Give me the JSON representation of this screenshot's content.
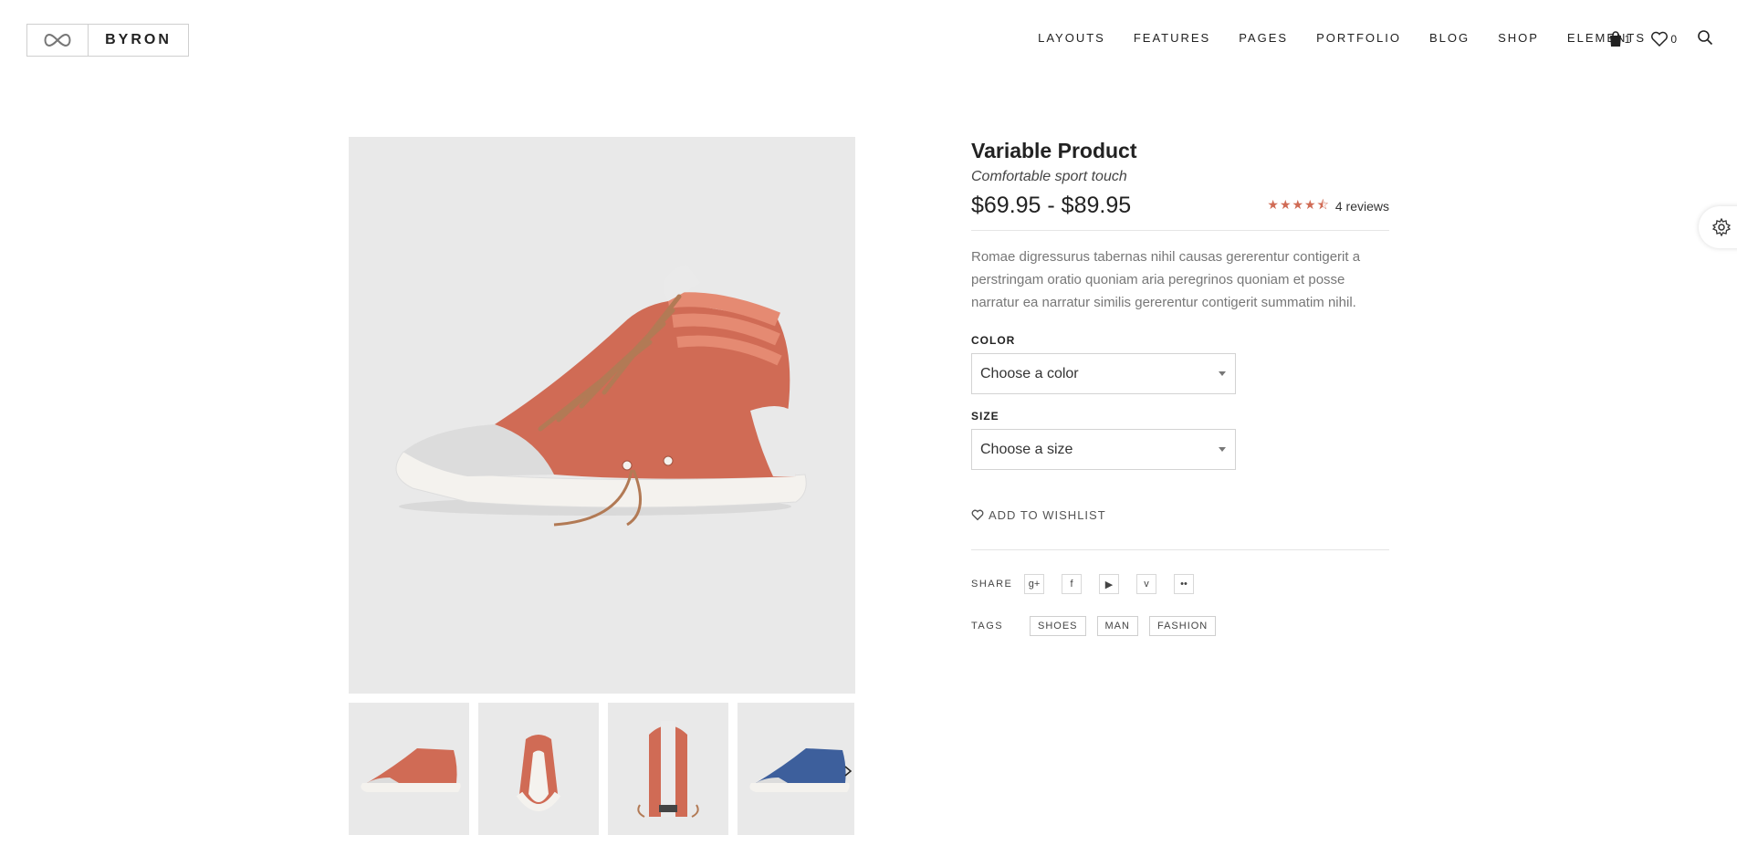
{
  "brand": {
    "name": "BYRON",
    "logo_icon": "infinity-icon"
  },
  "nav": {
    "items": [
      "LAYOUTS",
      "FEATURES",
      "PAGES",
      "PORTFOLIO",
      "BLOG",
      "SHOP",
      "ELEMENTS"
    ]
  },
  "header_icons": {
    "cart_count": "1",
    "wishlist_count": "0",
    "search_icon": "search-icon"
  },
  "product": {
    "title": "Variable Product",
    "subtitle": "Comfortable sport touch",
    "price": "$69.95 - $89.95",
    "rating": 4.5,
    "reviews_text": "4 reviews",
    "description": "Romae digressurus tabernas nihil causas gererentur contigerit a perstringam oratio quoniam aria peregrinos quoniam et posse narratur ea narratur similis gererentur contigerit summatim nihil.",
    "color_label": "COLOR",
    "color_placeholder": "Choose a color",
    "size_label": "SIZE",
    "size_placeholder": "Choose a size",
    "wishlist_label": "ADD TO WISHLIST",
    "share_label": "SHARE",
    "share_icons": [
      "google-plus-icon",
      "facebook-icon",
      "youtube-icon",
      "vimeo-icon",
      "flickr-icon"
    ],
    "tags_label": "TAGS",
    "tags": [
      "SHOES",
      "MAN",
      "FASHION"
    ]
  },
  "colors": {
    "accent": "#d06b55",
    "shoe_orange": "#d06b55",
    "shoe_blue": "#3d5f9c",
    "image_bg": "#e9e9e9"
  }
}
